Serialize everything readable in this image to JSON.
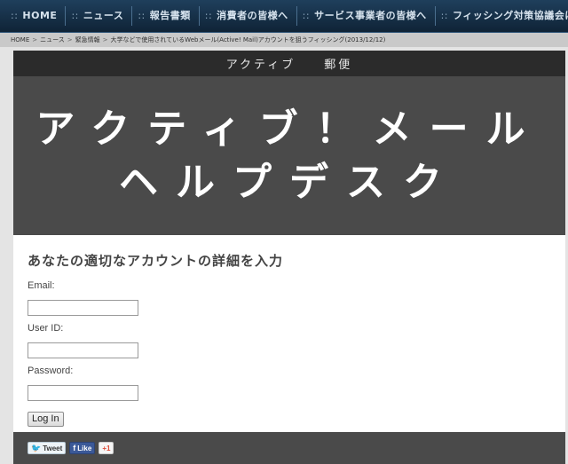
{
  "topnav": {
    "items": [
      {
        "dots": "::",
        "label": "HOME"
      },
      {
        "dots": "::",
        "label": "ニュース"
      },
      {
        "dots": "::",
        "label": "報告書類"
      },
      {
        "dots": "::",
        "label": "消費者の皆様へ"
      },
      {
        "dots": "::",
        "label": "サービス事業者の皆様へ"
      },
      {
        "dots": "::",
        "label": "フィッシング対策協議会について"
      }
    ]
  },
  "breadcrumb": {
    "items": [
      "HOME",
      "ニュース",
      "緊急情報",
      "大学などで使用されているWebメール(Active! Mail)アカウントを狙うフィッシング(2013/12/12)"
    ],
    "separator": ">"
  },
  "phish": {
    "title_left": "アクティブ",
    "title_right": "郵便",
    "hero_line1": "アクティブ！メール",
    "hero_line2": "ヘルプデスク",
    "heading": "あなたの適切なアカウントの詳細を入力",
    "email_label": "Email:",
    "userid_label": "User ID:",
    "password_label": "Password:",
    "login_label": "Log In"
  },
  "footer": {
    "tweet_label": "Tweet",
    "like_label": "Like",
    "gplus_label": "+1",
    "tweet_icon": "twitter-bird-icon",
    "like_icon": "facebook-f-icon"
  }
}
